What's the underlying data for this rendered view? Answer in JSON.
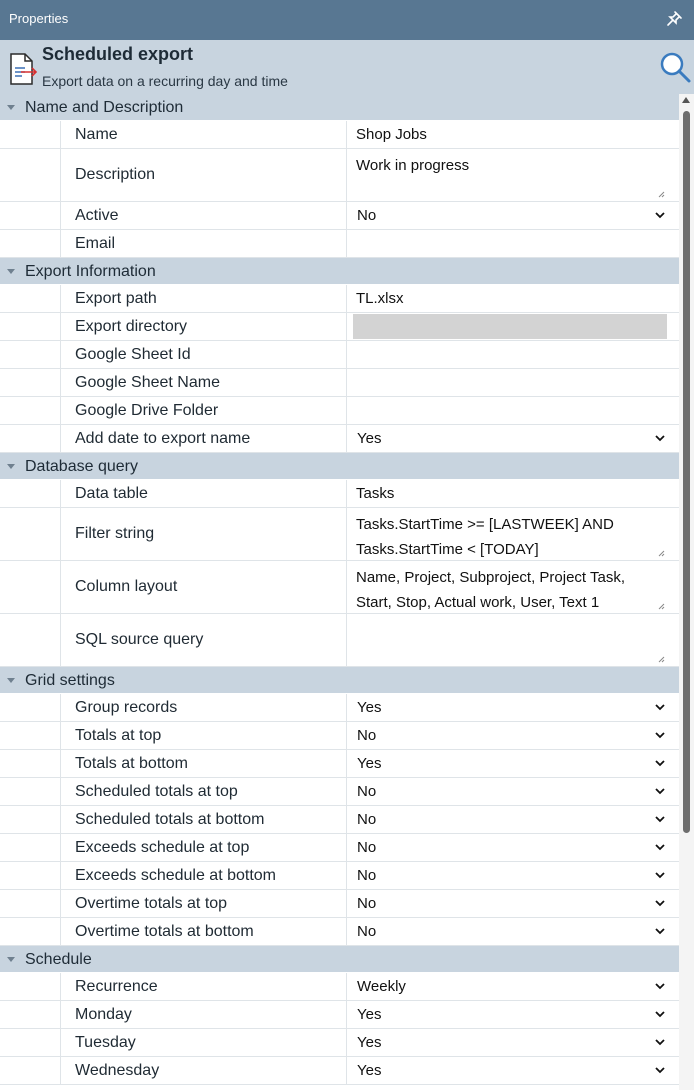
{
  "panel": {
    "title": "Properties",
    "pin_icon": "pin-icon"
  },
  "header": {
    "title": "Scheduled export",
    "subtitle": "Export data on a recurring day and time",
    "icon": "document-export-icon",
    "search_icon": "search-icon"
  },
  "categories": [
    {
      "name": "Name and Description",
      "rows": [
        {
          "label": "Name",
          "value": "Shop Jobs",
          "type": "text"
        },
        {
          "label": "Description",
          "value": "Work in progress",
          "type": "multiline",
          "lines": 2
        },
        {
          "label": "Active",
          "value": "No",
          "type": "select"
        },
        {
          "label": "Email",
          "value": "",
          "type": "text"
        }
      ]
    },
    {
      "name": "Export Information",
      "rows": [
        {
          "label": "Export path",
          "value": "TL.xlsx",
          "type": "text"
        },
        {
          "label": "Export directory",
          "value": "",
          "type": "disabled"
        },
        {
          "label": "Google Sheet Id",
          "value": "",
          "type": "text"
        },
        {
          "label": "Google Sheet Name",
          "value": "",
          "type": "text"
        },
        {
          "label": "Google Drive Folder",
          "value": "",
          "type": "text"
        },
        {
          "label": "Add date to export name",
          "value": "Yes",
          "type": "select"
        }
      ]
    },
    {
      "name": "Database query",
      "rows": [
        {
          "label": "Data table",
          "value": "Tasks",
          "type": "text"
        },
        {
          "label": "Filter string",
          "value": "Tasks.StartTime >= [LASTWEEK] AND\nTasks.StartTime < [TODAY]",
          "type": "multiline",
          "lines": 2
        },
        {
          "label": "Column layout",
          "value": "Name, Project, Subproject, Project Task,\nStart, Stop, Actual work, User, Text 1",
          "type": "multiline",
          "lines": 2
        },
        {
          "label": "SQL source query",
          "value": "",
          "type": "multiline",
          "lines": 2
        }
      ]
    },
    {
      "name": "Grid settings",
      "rows": [
        {
          "label": "Group records",
          "value": "Yes",
          "type": "select"
        },
        {
          "label": "Totals at top",
          "value": "No",
          "type": "select"
        },
        {
          "label": "Totals at bottom",
          "value": "Yes",
          "type": "select"
        },
        {
          "label": "Scheduled totals at top",
          "value": "No",
          "type": "select"
        },
        {
          "label": "Scheduled totals at bottom",
          "value": "No",
          "type": "select"
        },
        {
          "label": "Exceeds schedule at top",
          "value": "No",
          "type": "select"
        },
        {
          "label": "Exceeds schedule at bottom",
          "value": "No",
          "type": "select"
        },
        {
          "label": "Overtime totals at top",
          "value": "No",
          "type": "select"
        },
        {
          "label": "Overtime totals at bottom",
          "value": "No",
          "type": "select"
        }
      ]
    },
    {
      "name": "Schedule",
      "rows": [
        {
          "label": "Recurrence",
          "value": "Weekly",
          "type": "select"
        },
        {
          "label": "Monday",
          "value": "Yes",
          "type": "select"
        },
        {
          "label": "Tuesday",
          "value": "Yes",
          "type": "select"
        },
        {
          "label": "Wednesday",
          "value": "Yes",
          "type": "select"
        }
      ]
    }
  ]
}
